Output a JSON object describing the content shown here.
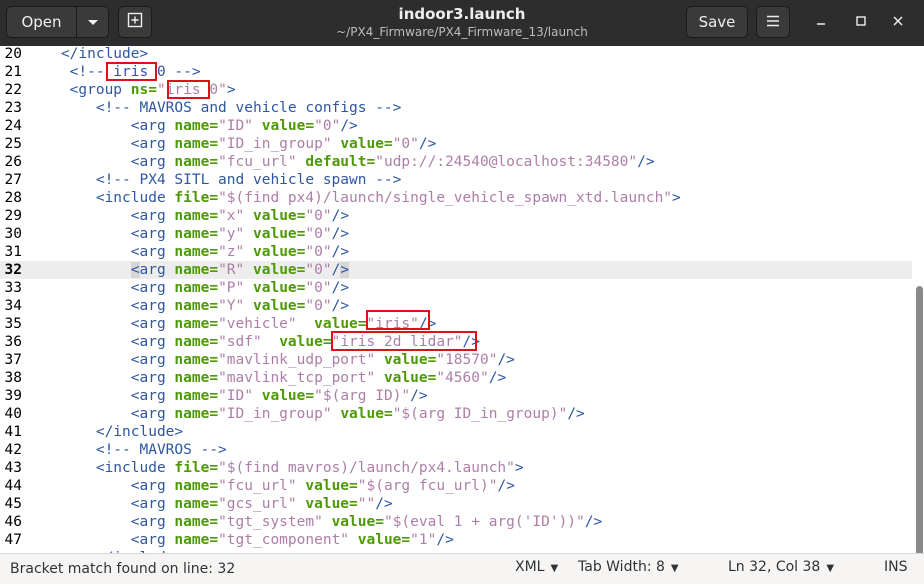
{
  "header": {
    "open_label": "Open",
    "save_label": "Save",
    "title": "indoor3.launch",
    "subtitle": "~/PX4_Firmware/PX4_Firmware_13/launch"
  },
  "icons": {
    "dropdown": "chevron-down-icon",
    "new_tab": "new-tab-icon",
    "menu": "hamburger-menu-icon",
    "minimize": "minimize-icon",
    "maximize": "maximize-icon",
    "close": "close-icon"
  },
  "editor": {
    "current_line": 32,
    "lines": [
      {
        "n": "20",
        "tokens": [
          [
            "t",
            "    "
          ],
          [
            "g",
            "</include>"
          ]
        ]
      },
      {
        "n": "21",
        "tokens": [
          [
            "t",
            "     "
          ],
          [
            "c",
            "<!-- iris_0 -->"
          ]
        ]
      },
      {
        "n": "22",
        "tokens": [
          [
            "t",
            "     "
          ],
          [
            "g",
            "<group "
          ],
          [
            "a",
            "ns="
          ],
          [
            "s",
            "\"iris_0\""
          ],
          [
            "g",
            ">"
          ]
        ]
      },
      {
        "n": "23",
        "tokens": [
          [
            "t",
            "        "
          ],
          [
            "c",
            "<!-- MAVROS and vehicle configs -->"
          ]
        ]
      },
      {
        "n": "24",
        "tokens": [
          [
            "t",
            "            "
          ],
          [
            "g",
            "<arg "
          ],
          [
            "a",
            "name="
          ],
          [
            "s",
            "\"ID\""
          ],
          [
            "t",
            " "
          ],
          [
            "a",
            "value="
          ],
          [
            "s",
            "\"0\""
          ],
          [
            "g",
            "/>"
          ]
        ]
      },
      {
        "n": "25",
        "tokens": [
          [
            "t",
            "            "
          ],
          [
            "g",
            "<arg "
          ],
          [
            "a",
            "name="
          ],
          [
            "s",
            "\"ID_in_group\""
          ],
          [
            "t",
            " "
          ],
          [
            "a",
            "value="
          ],
          [
            "s",
            "\"0\""
          ],
          [
            "g",
            "/>"
          ]
        ]
      },
      {
        "n": "26",
        "tokens": [
          [
            "t",
            "            "
          ],
          [
            "g",
            "<arg "
          ],
          [
            "a",
            "name="
          ],
          [
            "s",
            "\"fcu_url\""
          ],
          [
            "t",
            " "
          ],
          [
            "a",
            "default="
          ],
          [
            "s",
            "\"udp://:24540@localhost:34580\""
          ],
          [
            "g",
            "/>"
          ]
        ]
      },
      {
        "n": "27",
        "tokens": [
          [
            "t",
            "        "
          ],
          [
            "c",
            "<!-- PX4 SITL and vehicle spawn -->"
          ]
        ]
      },
      {
        "n": "28",
        "tokens": [
          [
            "t",
            "        "
          ],
          [
            "g",
            "<include "
          ],
          [
            "a",
            "file="
          ],
          [
            "s",
            "\"$(find px4)/launch/single_vehicle_spawn_xtd.launch\""
          ],
          [
            "g",
            ">"
          ]
        ]
      },
      {
        "n": "29",
        "tokens": [
          [
            "t",
            "            "
          ],
          [
            "g",
            "<arg "
          ],
          [
            "a",
            "name="
          ],
          [
            "s",
            "\"x\""
          ],
          [
            "t",
            " "
          ],
          [
            "a",
            "value="
          ],
          [
            "s",
            "\"0\""
          ],
          [
            "g",
            "/>"
          ]
        ]
      },
      {
        "n": "30",
        "tokens": [
          [
            "t",
            "            "
          ],
          [
            "g",
            "<arg "
          ],
          [
            "a",
            "name="
          ],
          [
            "s",
            "\"y\""
          ],
          [
            "t",
            " "
          ],
          [
            "a",
            "value="
          ],
          [
            "s",
            "\"0\""
          ],
          [
            "g",
            "/>"
          ]
        ]
      },
      {
        "n": "31",
        "tokens": [
          [
            "t",
            "            "
          ],
          [
            "g",
            "<arg "
          ],
          [
            "a",
            "name="
          ],
          [
            "s",
            "\"z\""
          ],
          [
            "t",
            " "
          ],
          [
            "a",
            "value="
          ],
          [
            "s",
            "\"0\""
          ],
          [
            "g",
            "/>"
          ]
        ]
      },
      {
        "n": "32",
        "tokens": [
          [
            "t",
            "            "
          ],
          [
            "gb",
            "<"
          ],
          [
            "g",
            "arg "
          ],
          [
            "a",
            "name="
          ],
          [
            "s",
            "\"R\""
          ],
          [
            "t",
            " "
          ],
          [
            "a",
            "value="
          ],
          [
            "s",
            "\"0\""
          ],
          [
            "g",
            "/"
          ],
          [
            "gb",
            ">"
          ]
        ]
      },
      {
        "n": "33",
        "tokens": [
          [
            "t",
            "            "
          ],
          [
            "g",
            "<arg "
          ],
          [
            "a",
            "name="
          ],
          [
            "s",
            "\"P\""
          ],
          [
            "t",
            " "
          ],
          [
            "a",
            "value="
          ],
          [
            "s",
            "\"0\""
          ],
          [
            "g",
            "/>"
          ]
        ]
      },
      {
        "n": "34",
        "tokens": [
          [
            "t",
            "            "
          ],
          [
            "g",
            "<arg "
          ],
          [
            "a",
            "name="
          ],
          [
            "s",
            "\"Y\""
          ],
          [
            "t",
            " "
          ],
          [
            "a",
            "value="
          ],
          [
            "s",
            "\"0\""
          ],
          [
            "g",
            "/>"
          ]
        ]
      },
      {
        "n": "35",
        "tokens": [
          [
            "t",
            "            "
          ],
          [
            "g",
            "<arg "
          ],
          [
            "a",
            "name="
          ],
          [
            "s",
            "\"vehicle\""
          ],
          [
            "t",
            "  "
          ],
          [
            "a",
            "value="
          ],
          [
            "s",
            "\"iris\""
          ],
          [
            "g",
            "/>"
          ]
        ]
      },
      {
        "n": "36",
        "tokens": [
          [
            "t",
            "            "
          ],
          [
            "g",
            "<arg "
          ],
          [
            "a",
            "name="
          ],
          [
            "s",
            "\"sdf\""
          ],
          [
            "t",
            "  "
          ],
          [
            "a",
            "value="
          ],
          [
            "s",
            "\"iris_2d_lidar\""
          ],
          [
            "g",
            "/>"
          ]
        ]
      },
      {
        "n": "37",
        "tokens": [
          [
            "t",
            "            "
          ],
          [
            "g",
            "<arg "
          ],
          [
            "a",
            "name="
          ],
          [
            "s",
            "\"mavlink_udp_port\""
          ],
          [
            "t",
            " "
          ],
          [
            "a",
            "value="
          ],
          [
            "s",
            "\"18570\""
          ],
          [
            "g",
            "/>"
          ]
        ]
      },
      {
        "n": "38",
        "tokens": [
          [
            "t",
            "            "
          ],
          [
            "g",
            "<arg "
          ],
          [
            "a",
            "name="
          ],
          [
            "s",
            "\"mavlink_tcp_port\""
          ],
          [
            "t",
            " "
          ],
          [
            "a",
            "value="
          ],
          [
            "s",
            "\"4560\""
          ],
          [
            "g",
            "/>"
          ]
        ]
      },
      {
        "n": "39",
        "tokens": [
          [
            "t",
            "            "
          ],
          [
            "g",
            "<arg "
          ],
          [
            "a",
            "name="
          ],
          [
            "s",
            "\"ID\""
          ],
          [
            "t",
            " "
          ],
          [
            "a",
            "value="
          ],
          [
            "s",
            "\"$(arg ID)\""
          ],
          [
            "g",
            "/>"
          ]
        ]
      },
      {
        "n": "40",
        "tokens": [
          [
            "t",
            "            "
          ],
          [
            "g",
            "<arg "
          ],
          [
            "a",
            "name="
          ],
          [
            "s",
            "\"ID_in_group\""
          ],
          [
            "t",
            " "
          ],
          [
            "a",
            "value="
          ],
          [
            "s",
            "\"$(arg ID_in_group)\""
          ],
          [
            "g",
            "/>"
          ]
        ]
      },
      {
        "n": "41",
        "tokens": [
          [
            "t",
            "        "
          ],
          [
            "g",
            "</include>"
          ]
        ]
      },
      {
        "n": "42",
        "tokens": [
          [
            "t",
            "        "
          ],
          [
            "c",
            "<!-- MAVROS -->"
          ]
        ]
      },
      {
        "n": "43",
        "tokens": [
          [
            "t",
            "        "
          ],
          [
            "g",
            "<include "
          ],
          [
            "a",
            "file="
          ],
          [
            "s",
            "\"$(find mavros)/launch/px4.launch\""
          ],
          [
            "g",
            ">"
          ]
        ]
      },
      {
        "n": "44",
        "tokens": [
          [
            "t",
            "            "
          ],
          [
            "g",
            "<arg "
          ],
          [
            "a",
            "name="
          ],
          [
            "s",
            "\"fcu_url\""
          ],
          [
            "t",
            " "
          ],
          [
            "a",
            "value="
          ],
          [
            "s",
            "\"$(arg fcu_url)\""
          ],
          [
            "g",
            "/>"
          ]
        ]
      },
      {
        "n": "45",
        "tokens": [
          [
            "t",
            "            "
          ],
          [
            "g",
            "<arg "
          ],
          [
            "a",
            "name="
          ],
          [
            "s",
            "\"gcs_url\""
          ],
          [
            "t",
            " "
          ],
          [
            "a",
            "value="
          ],
          [
            "s",
            "\"\""
          ],
          [
            "g",
            "/>"
          ]
        ]
      },
      {
        "n": "46",
        "tokens": [
          [
            "t",
            "            "
          ],
          [
            "g",
            "<arg "
          ],
          [
            "a",
            "name="
          ],
          [
            "s",
            "\"tgt_system\""
          ],
          [
            "t",
            " "
          ],
          [
            "a",
            "value="
          ],
          [
            "s",
            "\"$(eval 1 + arg('ID'))\""
          ],
          [
            "g",
            "/>"
          ]
        ]
      },
      {
        "n": "47",
        "tokens": [
          [
            "t",
            "            "
          ],
          [
            "g",
            "<arg "
          ],
          [
            "a",
            "name="
          ],
          [
            "s",
            "\"tgt_component\""
          ],
          [
            "t",
            " "
          ],
          [
            "a",
            "value="
          ],
          [
            "s",
            "\"1\""
          ],
          [
            "g",
            "/>"
          ]
        ]
      },
      {
        "n": "",
        "tokens": [
          [
            "t",
            "        "
          ],
          [
            "g",
            "</include>"
          ]
        ]
      }
    ]
  },
  "statusbar": {
    "message": "Bracket match found on line: 32",
    "language": "XML",
    "tab_width": "Tab Width: 8",
    "position": "Ln 32, Col 38",
    "mode": "INS"
  },
  "colors": {
    "annotation": "#e0101a",
    "tag": "#2e57a0",
    "attribute": "#4e9a06",
    "string": "#ad7fa8"
  }
}
